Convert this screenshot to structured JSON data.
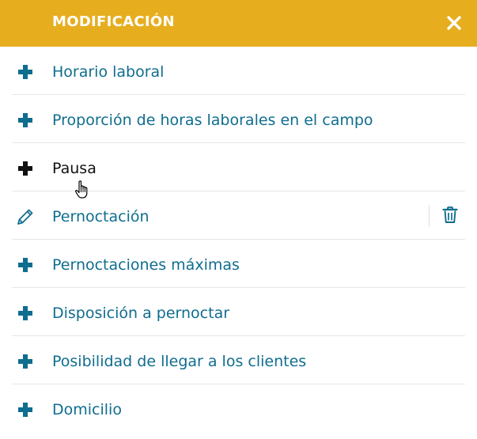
{
  "header": {
    "title": "MODIFICACIÓN",
    "close_icon": "close-icon",
    "background_color": "#e6ae1f"
  },
  "items": [
    {
      "label": "Horario laboral",
      "icon": "plus-icon"
    },
    {
      "label": "Proporción de horas laborales en el campo",
      "icon": "plus-icon"
    },
    {
      "label": "Pausa",
      "icon": "plus-icon",
      "state": "hover"
    },
    {
      "label": "Pernoctación",
      "icon": "pencil-icon",
      "action_icon": "trash-icon"
    },
    {
      "label": "Pernoctaciones máximas",
      "icon": "plus-icon"
    },
    {
      "label": "Disposición a pernoctar",
      "icon": "plus-icon"
    },
    {
      "label": "Posibilidad de llegar a los clientes",
      "icon": "plus-icon"
    },
    {
      "label": "Domicilio",
      "icon": "plus-icon"
    }
  ],
  "colors": {
    "accent": "#0f6d8f",
    "hover_text": "#111111"
  }
}
